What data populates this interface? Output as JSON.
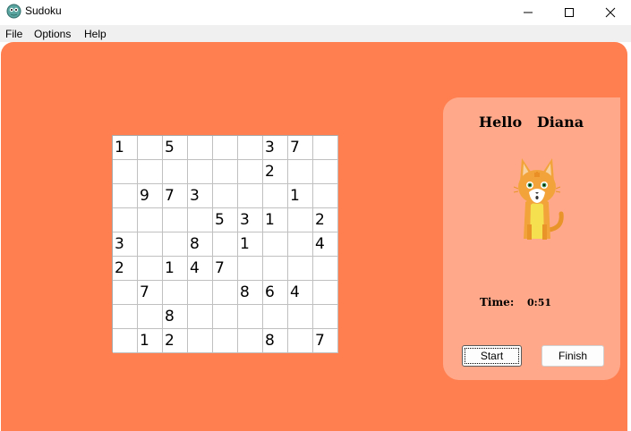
{
  "window": {
    "title": "Sudoku",
    "icon": "sudoku-app-icon",
    "controls": [
      "minimize-icon",
      "maximize-icon",
      "close-icon"
    ]
  },
  "menu": {
    "items": [
      "File",
      "Options",
      "Help"
    ]
  },
  "board": {
    "rows": [
      [
        "1",
        "",
        "5",
        "",
        "",
        "",
        "3",
        "7",
        ""
      ],
      [
        "",
        "",
        "",
        "",
        "",
        "",
        "2",
        "",
        ""
      ],
      [
        "",
        "9",
        "7",
        "3",
        "",
        "",
        "",
        "1",
        ""
      ],
      [
        "",
        "",
        "",
        "",
        "5",
        "3",
        "1",
        "",
        "2"
      ],
      [
        "3",
        "",
        "",
        "8",
        "",
        "1",
        "",
        "",
        "4"
      ],
      [
        "2",
        "",
        "1",
        "4",
        "7",
        "",
        "",
        "",
        ""
      ],
      [
        "",
        "7",
        "",
        "",
        "",
        "8",
        "6",
        "4",
        ""
      ],
      [
        "",
        "",
        "8",
        "",
        "",
        "",
        "",
        "",
        ""
      ],
      [
        "",
        "1",
        "2",
        "",
        "",
        "",
        "8",
        "",
        "7"
      ]
    ]
  },
  "sidebar": {
    "greeting": "Hello",
    "player_name": "Diana",
    "avatar": "cat-avatar-icon",
    "time_label": "Time:",
    "time_value": "0:51",
    "start_label": "Start",
    "finish_label": "Finish"
  },
  "colors": {
    "panel": "#ff7f50",
    "card": "#ffa98a",
    "cat_body": "#f2a43a",
    "cat_chest": "#f5e04f"
  }
}
